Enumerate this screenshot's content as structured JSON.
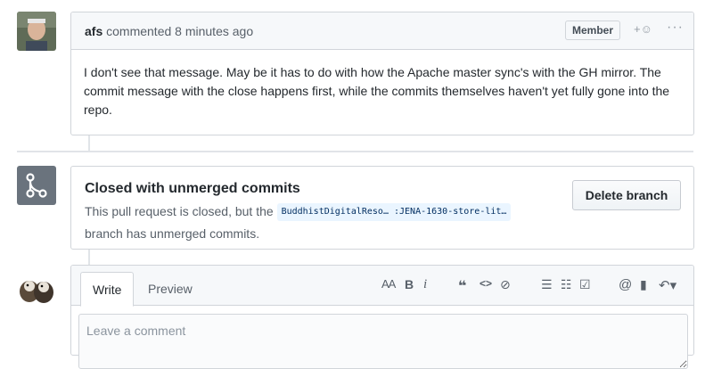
{
  "comment": {
    "author": "afs",
    "action": "commented 8 minutes ago",
    "badge": "Member",
    "reaction_glyph": "+☺",
    "more_glyph": "···",
    "body": "I don't see that message. May be it has to do with how the Apache master sync's with the GH mirror. The commit message with the close happens first, while the commits themselves haven't yet fully gone into the repo."
  },
  "closed_event": {
    "title": "Closed with unmerged commits",
    "desc_prefix": "This pull request is closed, but the",
    "branch": "BuddhistDigitalReso… :JENA-1630-store-lit…",
    "desc_suffix": "branch has unmerged commits.",
    "delete_label": "Delete branch"
  },
  "editor": {
    "tab_write": "Write",
    "tab_preview": "Preview",
    "placeholder": "Leave a comment",
    "toolbar": {
      "header": "AA",
      "bold": "B",
      "italic": "i",
      "quote": "❝",
      "code": "<>",
      "link": "⊘",
      "ul": "☰",
      "ol": "☷",
      "task": "☑",
      "mention": "@",
      "reference": "▮",
      "reply": "↶▾"
    }
  },
  "colors": {
    "border": "#d1d5da",
    "header_bg": "#f6f8fa",
    "merge_icon_bg": "#6a737d",
    "branch_bg": "#eaf5ff",
    "branch_fg": "#032f62"
  }
}
